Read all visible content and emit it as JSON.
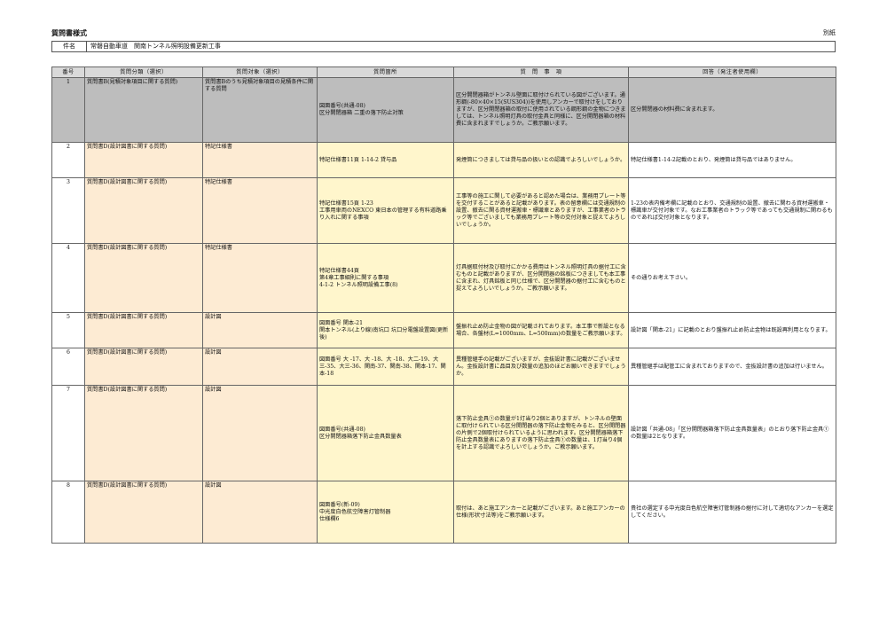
{
  "header": {
    "title": "質問書様式",
    "attachment": "別紙"
  },
  "subject": {
    "key": "件名",
    "value": "常磐自動車道　関南トンネル照明設備更新工事"
  },
  "columns": [
    "番号",
    "質問分類（選択）",
    "質問対象（選択）",
    "質問箇所",
    "質　問　事　項",
    "回答（発注者使用欄）"
  ],
  "rows": [
    {
      "no": "1",
      "category": "質問書B(見積対象項目に関する質問)",
      "target": "質問書Bのうち見積対象項目の見積条件に関する質問",
      "location": "図面番号(共通-08)\n区分開閉器箱 二重の落下防止対策",
      "question": "区分開閉器箱がトンネル壁面に取付けられている図がございます。通形鋼(-80×40×15(SUS304))を使用しアンカーで取付けをしておりますが、区分開閉器箱の取付に使用されている鋼形鋼の金物につきましては、トンネル照明灯具の取付金具と同様に、区分開閉器箱の材料費に含まれますでしょうか。ご教示願います。",
      "answer": "区分開閉器の材料費に含まれます。"
    },
    {
      "no": "2",
      "category": "質問書D(設計図書に関する質問)",
      "target": "特記仕様書",
      "location": "特記仕様書11頁 1-14-2 貸与品",
      "question": "発煙筒につきましては貸与品の扱いとの認識でよろしいでしょうか。",
      "answer": "特記仕様書1-14-2記載のとおり、発煙筒は貸与品ではありません。"
    },
    {
      "no": "3",
      "category": "質問書D(設計図書に関する質問)",
      "target": "特記仕様書",
      "location": "特記仕様書15頁 1-23\n工事用車両のNEXCO 東日本の管理する有料道路乗り入れに関する事項",
      "question": "工事等の施工に関して必要があると認めた場合は、業務用プレート等を交付することがあると記載があります。表の留意欄には交通規制の設置、撤去に関る資材運搬車・標識車とありますが、工事業者のトラック等でございましても業務用プレート等の交付対象と捉えてよろしいでしょうか。",
      "answer": "1-23の表内備考欄に記載のとおり、交通規制の設置、撤去に関わる資材運搬車・標識車が交付対象です。なお工事業者のトラック等であっても交通規制に関わるものであれば交付対象となります。"
    },
    {
      "no": "4",
      "category": "質問書D(設計図書に関する質問)",
      "target": "特記仕様書",
      "location": "特記仕様書44頁\n第4章工事細則に関する事項\n4-1-2 トンネル照明設備工事(8)",
      "question": "灯具据取付材及び取付にかかる費用はトンネル照明灯具の据付工に含むものと記載がありますが、区分開閉器の銘板につきましても本工事に含まれ、灯具銘板と同じ仕様で、区分開閉器の据付工に含むものと捉えてよろしいでしょうか。ご教示願います。",
      "answer": "その通りお考え下さい。"
    },
    {
      "no": "5",
      "category": "質問書D(設計図書に関する質問)",
      "target": "設計図",
      "location": "図面番号 関本-21\n関本トンネル(上り線)南坑口 坑口分電盤設置図(更新後)",
      "question": "盤振れ止め防止金物の図が記載されております。本工事で新設となる場合、各盤材(L=1000mm、L=500mm)の数量をご教示願います。",
      "answer": "設計図「関本-21」に記載のとおり盤振れ止め防止金物は既設再利用となります。"
    },
    {
      "no": "6",
      "category": "質問書D(設計図書に関する質問)",
      "target": "設計図",
      "location": "図面番号 大 -17、大 -18、大 -18、大二-19、大三-35、大三-36、関南-37、関南-38、関本-17、関本-18",
      "question": "異種管継手の記載がございますが、金抜設計書に記載がございません。金抜設計書に品目及び数量の追加のほどお願いできますでしょうか。",
      "answer": "異種管継手は配管工に含まれておりますので、金抜設計書の追加は行いません。"
    },
    {
      "no": "7",
      "category": "質問書D(設計図書に関する質問)",
      "target": "設計図",
      "location": "図面番号(共通-08)\n区分開閉器箱落下防止金具数量表",
      "question": "落下防止金具①の数量が1灯当り2個とありますが、トンネルの壁面に取付けられている区分開閉器の落下防止金物をみると、区分開閉器の片側で2個取付けられているように思われます。区分開閉器箱落下防止金具数量表にありますの落下防止金具①の数量は、1灯当り4個を計上する認識でよろしいでしょうか。ご教示願います。",
      "answer": "設計図「共通-08」「区分開閉器箱落下防止金具数量表」のとおり落下防止金具①の数量は2となります。"
    },
    {
      "no": "8",
      "category": "質問書D(設計図書に関する質問)",
      "target": "設計図",
      "location": "図面番号(新-09)\n中光度白色航空障害灯管制器\n仕様欄6",
      "question": "取付は、あと施工アンカーと記載がございます。あと施工アンカーの仕様(形状寸法等)をご教示願います。",
      "answer": "貴社の選定する中光度白色航空障害灯管制器の据付に対して適切なアンカーを選定してください。"
    }
  ]
}
